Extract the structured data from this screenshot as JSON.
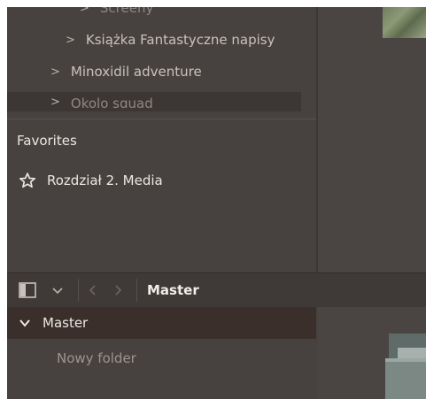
{
  "tree": {
    "items": [
      {
        "label": "Screeny",
        "indent": 1,
        "faded": true
      },
      {
        "label": "Książka Fantastyczne napisy",
        "indent": 1,
        "faded": false
      },
      {
        "label": "Minoxidil adventure",
        "indent": 0,
        "faded": false
      },
      {
        "label": "Okolo squad",
        "indent": 0,
        "faded": true
      }
    ]
  },
  "favorites": {
    "title": "Favorites",
    "items": [
      {
        "label": "Rozdział 2. Media",
        "icon": "star-icon"
      }
    ]
  },
  "toolbar": {
    "sidebar_toggle_icon": "sidebar-toggle-icon",
    "dropdown_icon": "chevron-down-icon",
    "back_icon": "chevron-left-icon",
    "forward_icon": "chevron-right-icon",
    "title": "Master"
  },
  "library": {
    "root_label": "Master",
    "children": [
      {
        "label": "Nowy folder"
      }
    ]
  },
  "colors": {
    "panel_bg": "#47423f",
    "selected_row_bg": "#3b2f2b",
    "text_primary": "#ece7e2",
    "text_secondary": "#9c948e"
  }
}
